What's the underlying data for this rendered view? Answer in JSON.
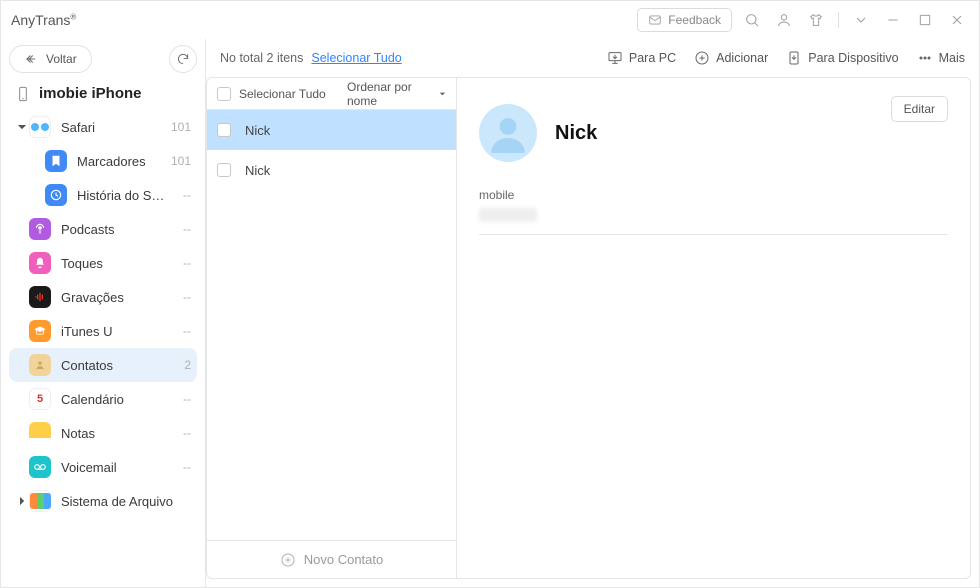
{
  "titlebar": {
    "brand": "AnyTrans",
    "feedback": "Feedback"
  },
  "sidebar": {
    "back": "Voltar",
    "device": "imobie iPhone",
    "nodes": [
      {
        "label": "Safari",
        "count": "101",
        "icon": "safari",
        "expandable": true,
        "expanded": true,
        "selected": false
      },
      {
        "label": "Marcadores",
        "count": "101",
        "icon": "bookmark",
        "child": true
      },
      {
        "label": "História do Safari",
        "count": "--",
        "icon": "history",
        "child": true
      },
      {
        "label": "Podcasts",
        "count": "--",
        "icon": "podcast"
      },
      {
        "label": "Toques",
        "count": "--",
        "icon": "ringtone"
      },
      {
        "label": "Gravações",
        "count": "--",
        "icon": "recording"
      },
      {
        "label": "iTunes U",
        "count": "--",
        "icon": "itunesu"
      },
      {
        "label": "Contatos",
        "count": "2",
        "icon": "contacts",
        "selected": true
      },
      {
        "label": "Calendário",
        "count": "--",
        "icon": "calendar"
      },
      {
        "label": "Notas",
        "count": "--",
        "icon": "notes"
      },
      {
        "label": "Voicemail",
        "count": "--",
        "icon": "voicemail"
      },
      {
        "label": "Sistema de Arquivo",
        "icon": "filesystem",
        "expandable": true,
        "expanded": false
      }
    ]
  },
  "toolbar": {
    "total_prefix": "No total 2 itens",
    "select_all_link": "Selecionar Tudo",
    "to_pc": "Para PC",
    "add": "Adicionar",
    "to_device": "Para Dispositivo",
    "more": "Mais"
  },
  "list": {
    "header": {
      "select_all": "Selecionar Tudo",
      "sort": "Ordenar por nome"
    },
    "rows": [
      {
        "name": "Nick",
        "selected": true
      },
      {
        "name": "Nick",
        "selected": false
      }
    ],
    "new_contact": "Novo Contato"
  },
  "detail": {
    "edit": "Editar",
    "name": "Nick",
    "field_label": "mobile"
  }
}
